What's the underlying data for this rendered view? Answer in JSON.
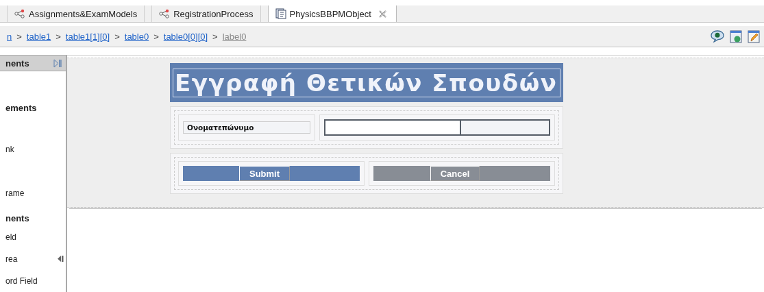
{
  "tabs": [
    {
      "label": "Assignments&ExamModels",
      "kind": "process",
      "selected": false,
      "closable": false
    },
    {
      "label": "RegistrationProcess",
      "kind": "process",
      "selected": false,
      "closable": false
    },
    {
      "label": "PhysicsBBPMObject",
      "kind": "object",
      "selected": true,
      "closable": true
    }
  ],
  "breadcrumb": [
    {
      "label": "n",
      "link": true
    },
    {
      "label": "table1",
      "link": true
    },
    {
      "label": "table1[1][0]",
      "link": true
    },
    {
      "label": "table0",
      "link": true
    },
    {
      "label": "table0[0][0]",
      "link": true
    },
    {
      "label": "label0",
      "link": false
    }
  ],
  "breadcrumb_separator": ">",
  "palette": {
    "title": "nents",
    "items": [
      {
        "label": "ements",
        "kind": "heading"
      },
      {
        "label": "nk",
        "kind": "item"
      },
      {
        "label": "rame",
        "kind": "item"
      },
      {
        "label": "nents",
        "kind": "heading"
      },
      {
        "label": "eld",
        "kind": "item"
      },
      {
        "label": "rea",
        "kind": "item"
      },
      {
        "label": "ord Field",
        "kind": "item"
      }
    ]
  },
  "form": {
    "title": "Εγγραφή Θετικών Σπουδών",
    "field_label": "Ονοματεπώνυμο",
    "buttons": [
      {
        "label": "Submit",
        "kind": "primary"
      },
      {
        "label": "Cancel",
        "kind": "secondary"
      }
    ]
  }
}
